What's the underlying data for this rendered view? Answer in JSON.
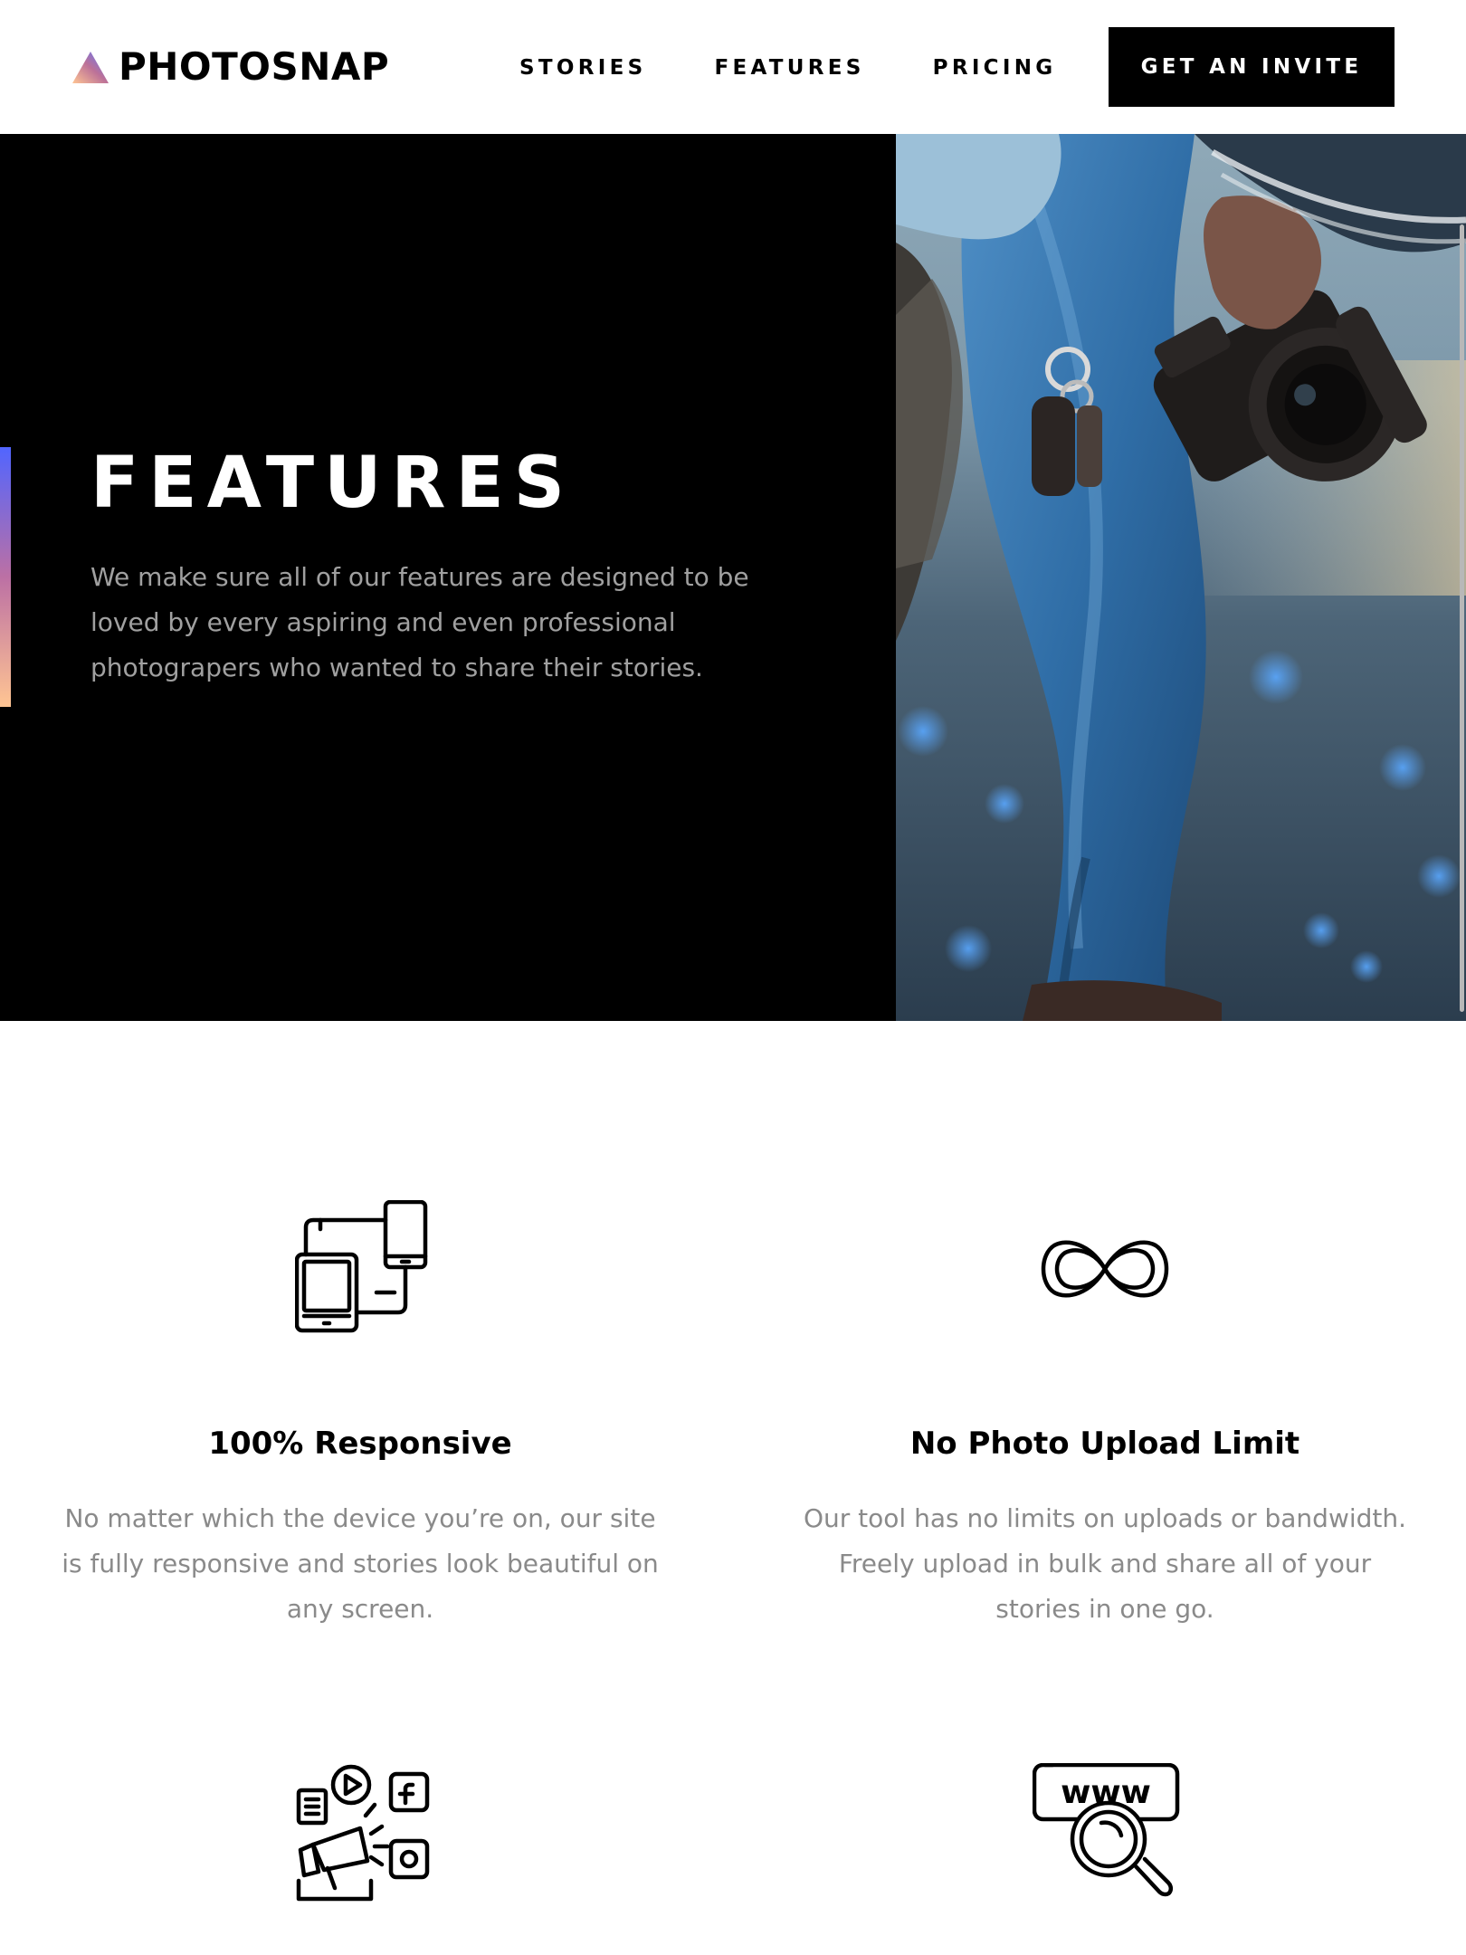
{
  "brand": {
    "name": "PHOTOSNAP",
    "gradient_colors": [
      "#ffc593",
      "#bc7198",
      "#5a77ff"
    ]
  },
  "nav": {
    "items": [
      {
        "label": "STORIES"
      },
      {
        "label": "FEATURES"
      },
      {
        "label": "PRICING"
      }
    ],
    "cta_label": "GET AN INVITE"
  },
  "hero": {
    "title": "FEATURES",
    "description": "We make sure all of our features are designed to be loved by every aspiring and even professional photograpers who wanted to share their stories.",
    "image_alt": "photographer-holding-camera"
  },
  "features": [
    {
      "icon": "responsive-devices-icon",
      "title": "100% Responsive",
      "text": "No matter which the device you’re on, our site is fully responsive and stories look beautiful on any screen."
    },
    {
      "icon": "infinity-icon",
      "title": "No Photo Upload Limit",
      "text": "Our tool has no limits on uploads or bandwidth. Freely upload in bulk and share all of your stories in one go."
    },
    {
      "icon": "social-media-embed-icon",
      "title": "",
      "text": ""
    },
    {
      "icon": "custom-domain-search-icon",
      "title": "",
      "text": ""
    }
  ],
  "colors": {
    "background": "#ffffff",
    "hero_background": "#000000",
    "text_muted": "#8a8a8a",
    "accent_gradient_start": "#5165ff",
    "accent_gradient_end": "#ffc593"
  }
}
